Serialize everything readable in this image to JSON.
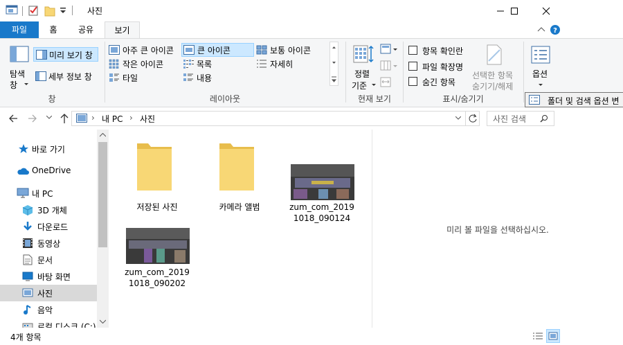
{
  "window": {
    "title": "사진",
    "quick_access_icons": [
      "explorer-icon",
      "properties-check-icon",
      "new-folder-icon",
      "customize-dropdown-icon"
    ]
  },
  "ribbon_tabs": {
    "file": "파일",
    "home": "홈",
    "share": "공유",
    "view": "보기",
    "active": "보기"
  },
  "ribbon": {
    "pane_group": {
      "nav_pane": "탐색",
      "nav_pane_line2": "창",
      "preview_pane": "미리 보기 창",
      "details_pane": "세부 정보 창",
      "label": "창"
    },
    "layout_group": {
      "extra_large": "아주 큰 아이콘",
      "large": "큰 아이콘",
      "medium": "보통 아이콘",
      "small": "작은 아이콘",
      "list": "목록",
      "details": "자세히",
      "tiles": "타일",
      "content": "내용",
      "selected": "큰 아이콘",
      "label": "레이아웃"
    },
    "current_view_group": {
      "sort_by": "정렬",
      "sort_by_line2": "기준",
      "label": "현재 보기"
    },
    "show_hide_group": {
      "item_checkboxes": "항목 확인란",
      "file_extensions": "파일 확장명",
      "hidden_items": "숨긴 항목",
      "hide_selected_line1": "선택한 항목",
      "hide_selected_line2": "숨기기/해제",
      "label": "표시/숨기기",
      "checked": {
        "item_checkboxes": false,
        "file_extensions": false,
        "hidden_items": false
      }
    },
    "options": {
      "label": "옵션"
    },
    "tooltip": "폴더 및 검색 옵션 변"
  },
  "address_bar": {
    "sep": "›",
    "crumbs": [
      "내 PC",
      "사진"
    ],
    "search_placeholder": "사진 검색"
  },
  "nav_pane": {
    "items": [
      {
        "label": "바로 가기",
        "icon": "star-icon"
      },
      {
        "label": "OneDrive",
        "icon": "cloud-icon"
      },
      {
        "label": "내 PC",
        "icon": "computer-icon"
      },
      {
        "label": "3D 개체",
        "icon": "cube-icon"
      },
      {
        "label": "다운로드",
        "icon": "download-arrow-icon"
      },
      {
        "label": "동영상",
        "icon": "film-icon"
      },
      {
        "label": "문서",
        "icon": "document-icon"
      },
      {
        "label": "바탕 화면",
        "icon": "desktop-icon"
      },
      {
        "label": "사진",
        "icon": "pictures-icon"
      },
      {
        "label": "음악",
        "icon": "music-note-icon"
      },
      {
        "label": "로컬 디스크 (C:)",
        "icon": "drive-icon"
      }
    ],
    "selected": "사진"
  },
  "content": {
    "items": [
      {
        "name": "저장된 사진",
        "kind": "folder"
      },
      {
        "name": "카메라 앨범",
        "kind": "folder"
      },
      {
        "name_line1": "zum_com_2019",
        "name_line2": "1018_090124",
        "kind": "image"
      },
      {
        "name_line1": "zum_com_2019",
        "name_line2": "1018_090202",
        "kind": "image"
      }
    ]
  },
  "preview_pane": {
    "message": "미리 볼 파일을 선택하십시오."
  },
  "status_bar": {
    "count": "4개 항목"
  },
  "colors": {
    "file_tab": "#1979ca",
    "selection": "#cce8ff",
    "folder": "#f8d775",
    "accent_blue": "#1979ca"
  }
}
